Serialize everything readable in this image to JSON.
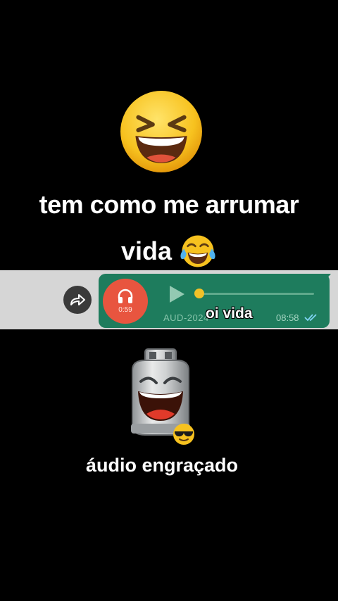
{
  "captions": {
    "line1": "tem como me arrumar",
    "line2": "vida",
    "bottom": "áudio engraçado"
  },
  "audio_message": {
    "duration": "0:59",
    "file_label": "AUD-2024",
    "overlay_text": "oi vida",
    "time": "08:58",
    "progress": 0.0
  },
  "icons": {
    "top": "grinning-squinting-face-icon",
    "inline": "tears-of-joy-icon",
    "forward": "forward-icon",
    "headphones": "headphones-icon",
    "play": "play-icon",
    "read": "double-check-icon",
    "sticker": "laughing-gas-canister",
    "sticker_badge": "sunglasses-face-icon"
  },
  "colors": {
    "background": "#000000",
    "strip": "#d6d6d6",
    "bubble": "#1e7c5d",
    "avatar": "#e8553f",
    "knob": "#f2c128"
  }
}
